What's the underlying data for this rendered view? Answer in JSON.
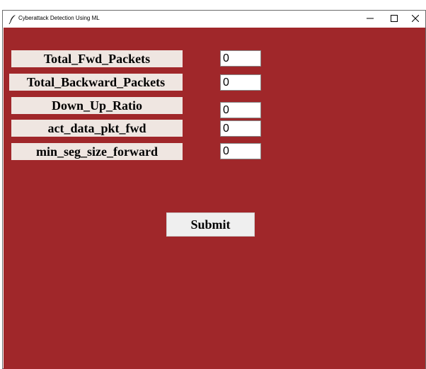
{
  "window": {
    "title": "Cyberattack Detection Using ML",
    "background_color": "#a0272a"
  },
  "fields": [
    {
      "label": "Total_Fwd_Packets",
      "value": "0"
    },
    {
      "label": "Total_Backward_Packets",
      "value": "0"
    },
    {
      "label": "Down_Up_Ratio",
      "value": "0"
    },
    {
      "label": "act_data_pkt_fwd",
      "value": "0"
    },
    {
      "label": "min_seg_size_forward",
      "value": "0"
    }
  ],
  "submit_label": "Submit",
  "icons": {
    "app": "feather-icon",
    "minimize": "minimize-icon",
    "maximize": "maximize-icon",
    "close": "close-icon"
  }
}
